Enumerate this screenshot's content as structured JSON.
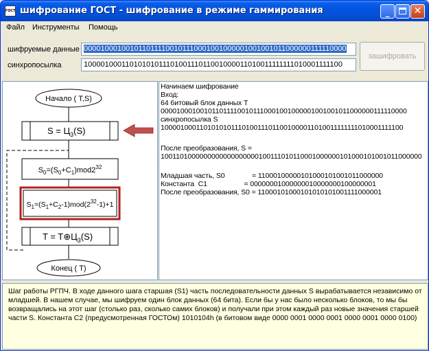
{
  "window": {
    "icon_text": "ГОСТ",
    "title": "шифрование ГОСТ - шифрование в режиме гаммирования",
    "minimize": "_",
    "close": "✕"
  },
  "menu": [
    "Файл",
    "Инструменты",
    "Помощь"
  ],
  "inputs": {
    "data_label": "шифруемые данные",
    "data_value": "0000100010010110111100101110001001000001001001011000000111110000",
    "sync_label": "синхропосылка",
    "sync_value": "1000010001101010101110100111011001000011010011111111010001111100",
    "encrypt_button": "зашифровать"
  },
  "flowchart": {
    "start": "Начало ( T,S)",
    "box1_main": "S =  Ц",
    "box1_sub": "3",
    "box1_tail": "(S)",
    "box2": "S0=(S0+C1)mod2^32",
    "box3": "S1=(S1+C2-1)mod(2^32-1)+1",
    "box4_main": "T = T⊕Ц",
    "box4_sub": "3",
    "box4_tail": "(S)",
    "end": "Конец ( T)",
    "accent_color": "#c0504d",
    "highlight_border": "#b22222"
  },
  "log": [
    "Начинаем шифрование",
    "Вход:",
    "64 битовый блок данных T",
    "0000100010010110111100101110001001000001001001011000000111110000",
    "синхропосылка S",
    "1000010001101010101110100111011001000011010011111111010001111100",
    "",
    "После преобразования, S =",
    "1001101000000000000000000100111010110001000000101000101001011000000",
    "",
    "Младшая часть, S0              = 11000100000101000101001011000000",
    "Константа  C1                   = 00000001000000010000000100000001",
    "После преобразования, S0 = 11000101000101010101001111000001"
  ],
  "description": "Шаг работы РГПЧ. В ходе данного шага старшая (S1) часть последовательности данных S вырабатывается независимо от младшей. В нашем случае, мы шифруем один блок данных (64 бита). Если бы у нас было несколько блоков, то мы бы возвращались на этот шаг (столько раз, сколько самих блоков) и получали при этом каждый раз новые значения старшей части S. Константа C2 (предусмотренная ГОСТОм) 1010104h (в битовом виде 0000 0001 0000 0001 0000 0001 0000 0100)"
}
